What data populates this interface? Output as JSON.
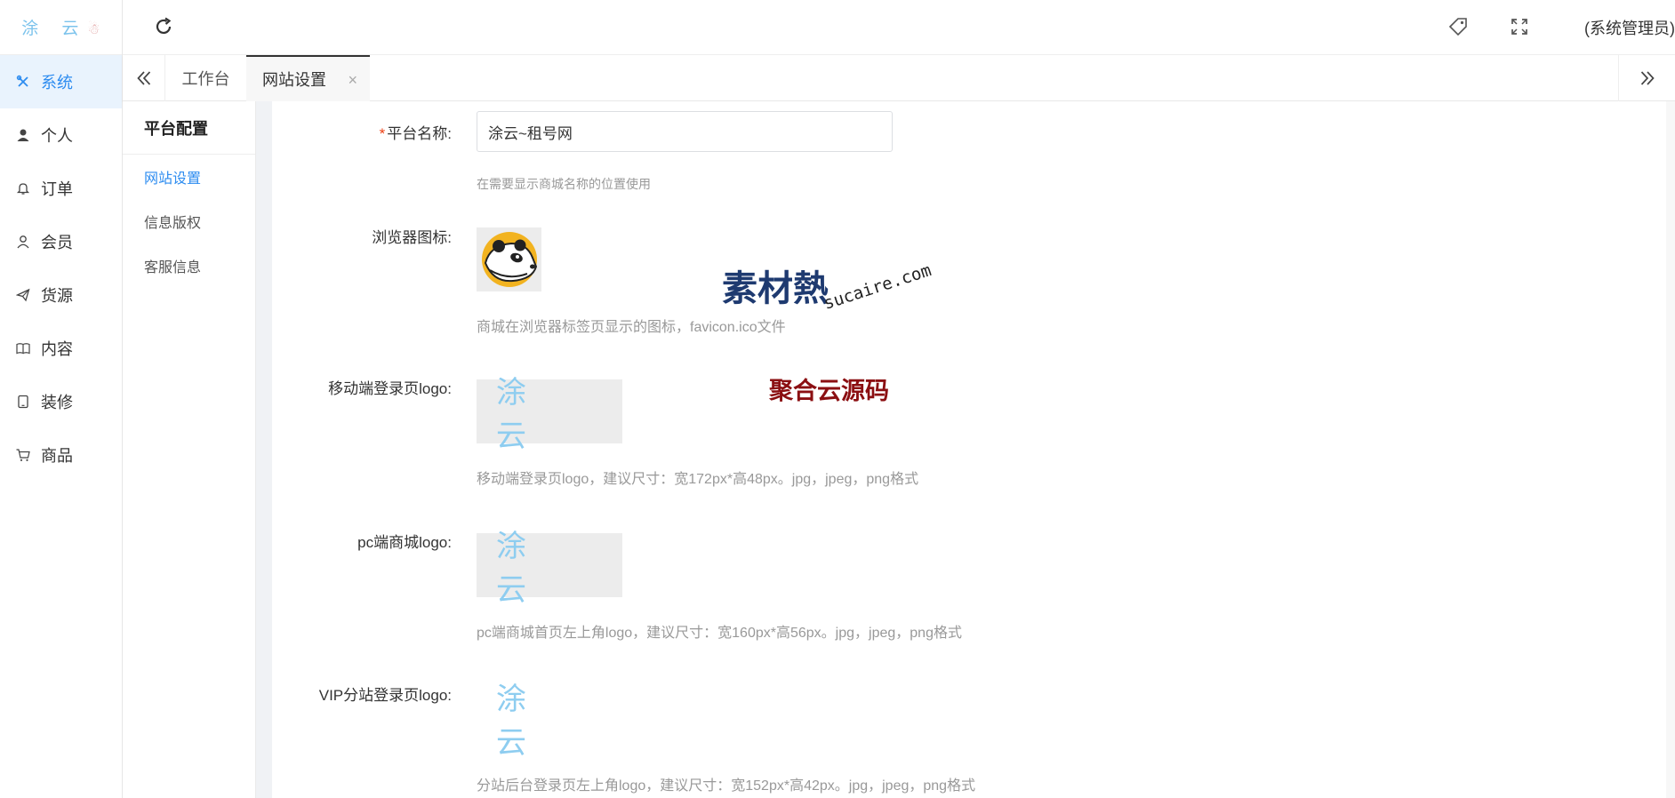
{
  "brand": {
    "logo_text": "涂 云",
    "mascot": "☃"
  },
  "sidebar": {
    "items": [
      {
        "label": "系统",
        "icon": "tools-icon",
        "active": true
      },
      {
        "label": "个人",
        "icon": "person-filled-icon",
        "active": false
      },
      {
        "label": "订单",
        "icon": "bell-icon",
        "active": false
      },
      {
        "label": "会员",
        "icon": "person-outline-icon",
        "active": false
      },
      {
        "label": "货源",
        "icon": "paper-plane-icon",
        "active": false
      },
      {
        "label": "内容",
        "icon": "book-icon",
        "active": false
      },
      {
        "label": "装修",
        "icon": "tablet-icon",
        "active": false
      },
      {
        "label": "商品",
        "icon": "cart-icon",
        "active": false
      }
    ]
  },
  "header": {
    "user_label": "(系统管理员)",
    "icons": [
      "refresh-icon",
      "tag-icon",
      "fullscreen-icon"
    ]
  },
  "tabs": {
    "items": [
      {
        "label": "工作台",
        "active": false
      },
      {
        "label": "网站设置",
        "active": true,
        "closable": true
      }
    ],
    "close_glyph": "×"
  },
  "submenu": {
    "title": "平台配置",
    "items": [
      {
        "label": "网站设置",
        "active": true
      },
      {
        "label": "信息版权",
        "active": false
      },
      {
        "label": "客服信息",
        "active": false
      }
    ]
  },
  "form": {
    "platform_name": {
      "required_mark": "*",
      "label": "平台名称:",
      "value": "涂云~租号网",
      "hint": "在需要显示商城名称的位置使用"
    },
    "browser_icon": {
      "label": "浏览器图标:",
      "hint": "商城在浏览器标签页显示的图标，favicon.ico文件"
    },
    "mobile_login_logo": {
      "label": "移动端登录页logo:",
      "logo_text": "涂 云",
      "hint": "移动端登录页logo，建议尺寸：宽172px*高48px。jpg，jpeg，png格式"
    },
    "pc_logo": {
      "label": "pc端商城logo:",
      "logo_text": "涂 云",
      "hint": "pc端商城首页左上角logo，建议尺寸：宽160px*高56px。jpg，jpeg，png格式"
    },
    "vip_login_logo": {
      "label": "VIP分站登录页logo:",
      "logo_text": "涂 云",
      "hint": "分站后台登录页左上角logo，建议尺寸：宽152px*高42px。jpg，jpeg，png格式"
    }
  },
  "watermarks": {
    "site_mark": "素材熱",
    "site_domain": "sucaire.com",
    "source_mark": "聚合云源码"
  },
  "colors": {
    "accent": "#2d8cf0",
    "active_bg": "#e9f3fd",
    "required": "#ed4014",
    "hint": "#999999",
    "logo_blue": "#8ecdf0"
  }
}
